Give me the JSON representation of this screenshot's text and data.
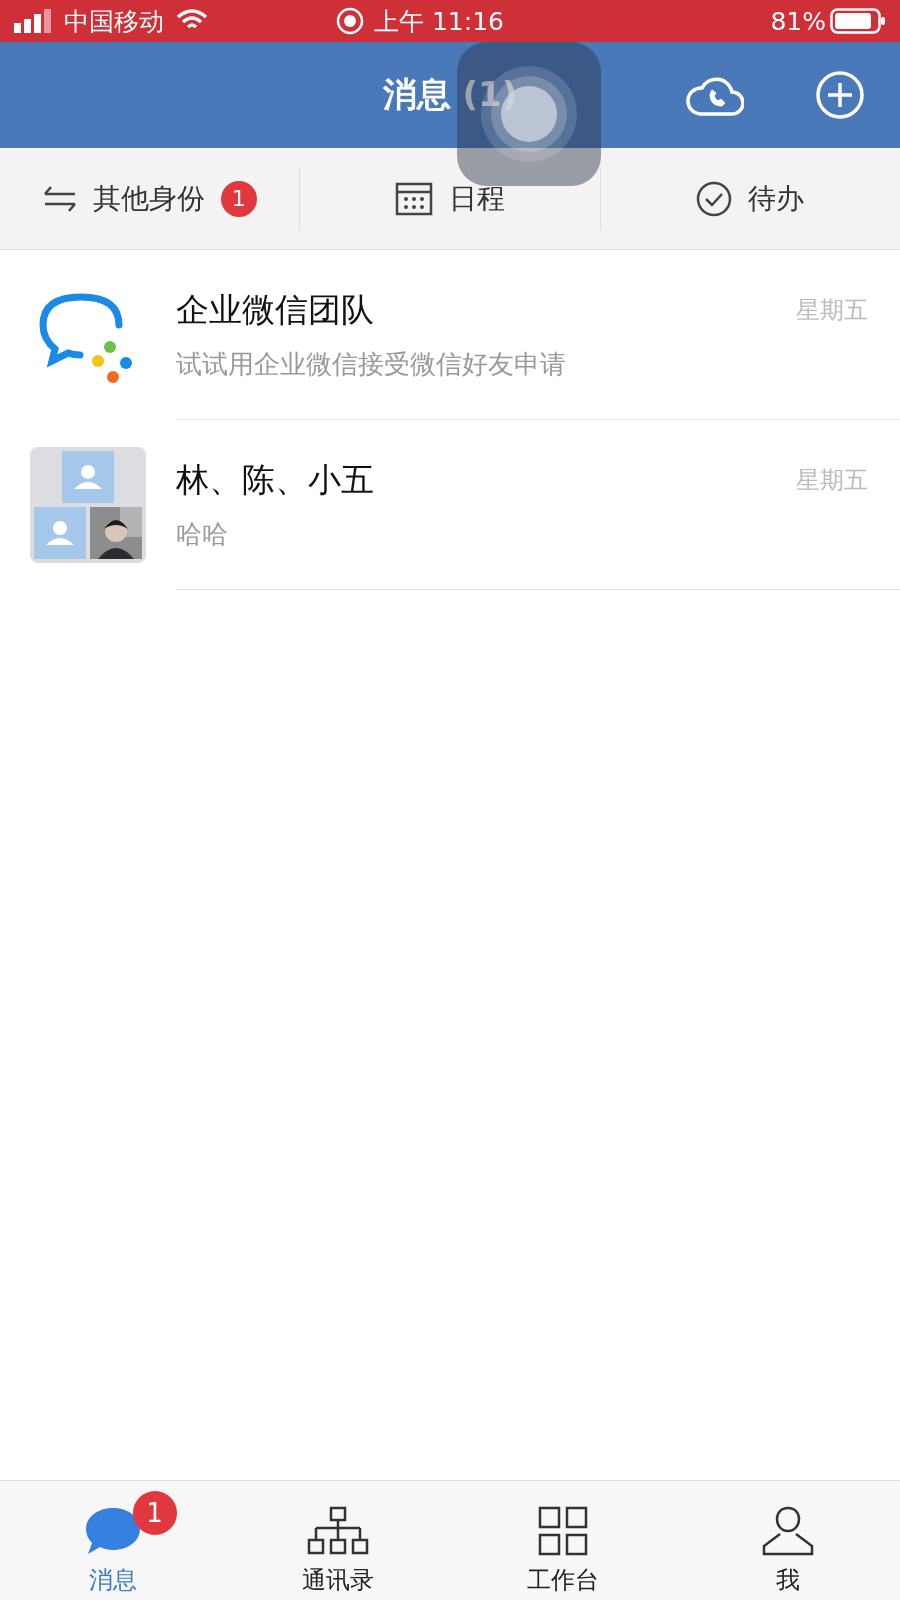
{
  "status_bar": {
    "carrier": "中国移动",
    "time": "上午 11:16",
    "battery": "81%"
  },
  "header": {
    "title": "消息 (1)"
  },
  "quick_actions": [
    {
      "label": "其他身份",
      "badge": "1"
    },
    {
      "label": "日程"
    },
    {
      "label": "待办"
    }
  ],
  "chats": [
    {
      "kind": "logo",
      "name": "企业微信团队",
      "preview": "试试用企业微信接受微信好友申请",
      "time": "星期五"
    },
    {
      "kind": "group",
      "name": "林、陈、小五",
      "preview": "哈哈",
      "time": "星期五"
    }
  ],
  "tabs": [
    {
      "label": "消息",
      "selected": true,
      "badge": "1"
    },
    {
      "label": "通讯录",
      "selected": false
    },
    {
      "label": "工作台",
      "selected": false
    },
    {
      "label": "我",
      "selected": false
    }
  ]
}
